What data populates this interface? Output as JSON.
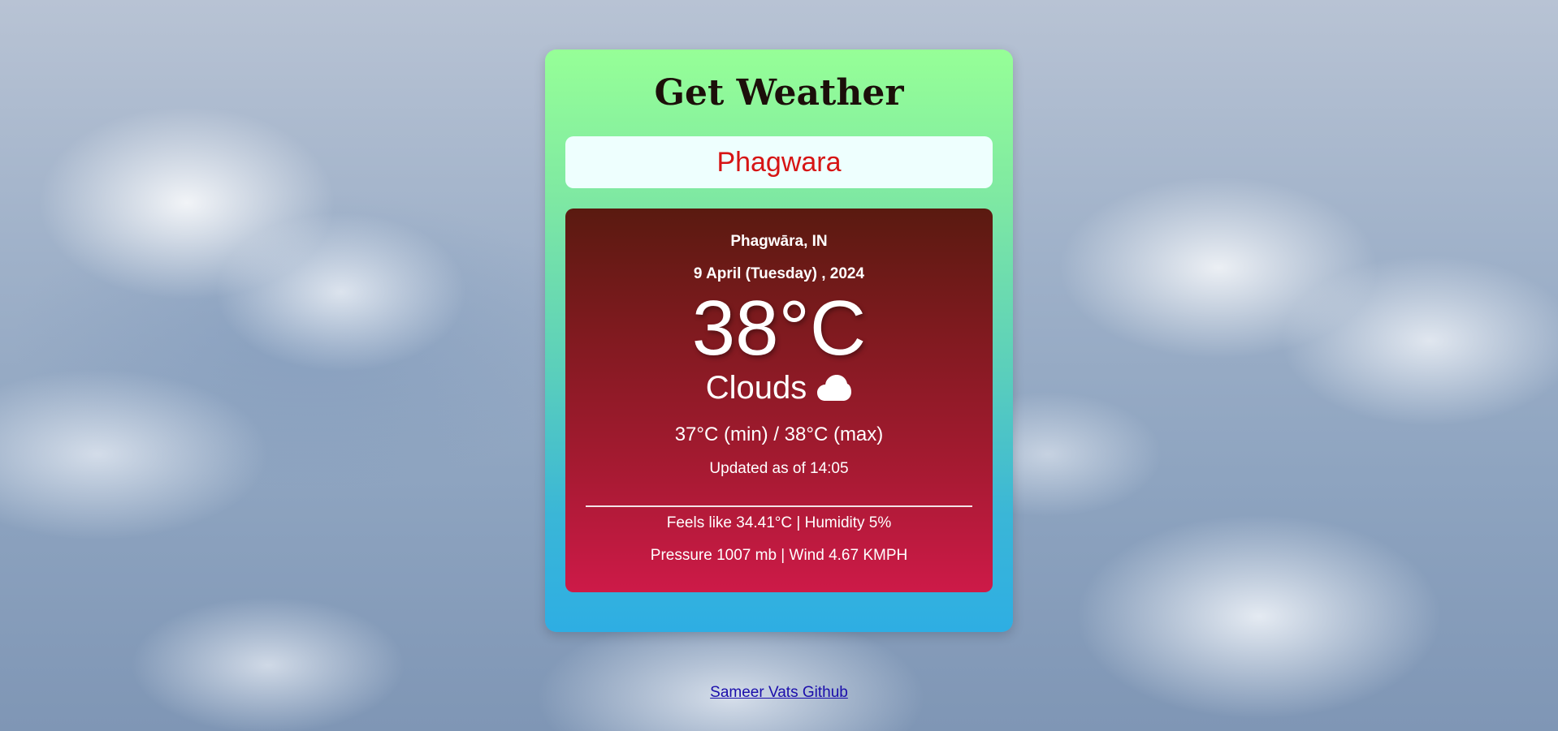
{
  "app": {
    "title": "Get Weather"
  },
  "search": {
    "value": "Phagwara"
  },
  "weather": {
    "location": "Phagwāra, IN",
    "date": "9 April (Tuesday) , 2024",
    "temperature": "38°C",
    "condition": "Clouds",
    "condition_icon": "cloud-icon",
    "min_max": "37°C (min) / 38°C (max)",
    "updated": "Updated as of 14:05",
    "feels_humidity": "Feels like 34.41°C | Humidity 5%",
    "pressure_wind": "Pressure 1007 mb | Wind 4.67 KMPH"
  },
  "footer": {
    "link_text": "Sameer Vats Github"
  },
  "colors": {
    "card_gradient_top": "#96ff97",
    "card_gradient_bottom": "#2eaee3",
    "panel_gradient_top": "#5a1a10",
    "panel_gradient_bottom": "#cd1a48",
    "search_text": "#d61414",
    "link": "#1a0dab"
  }
}
